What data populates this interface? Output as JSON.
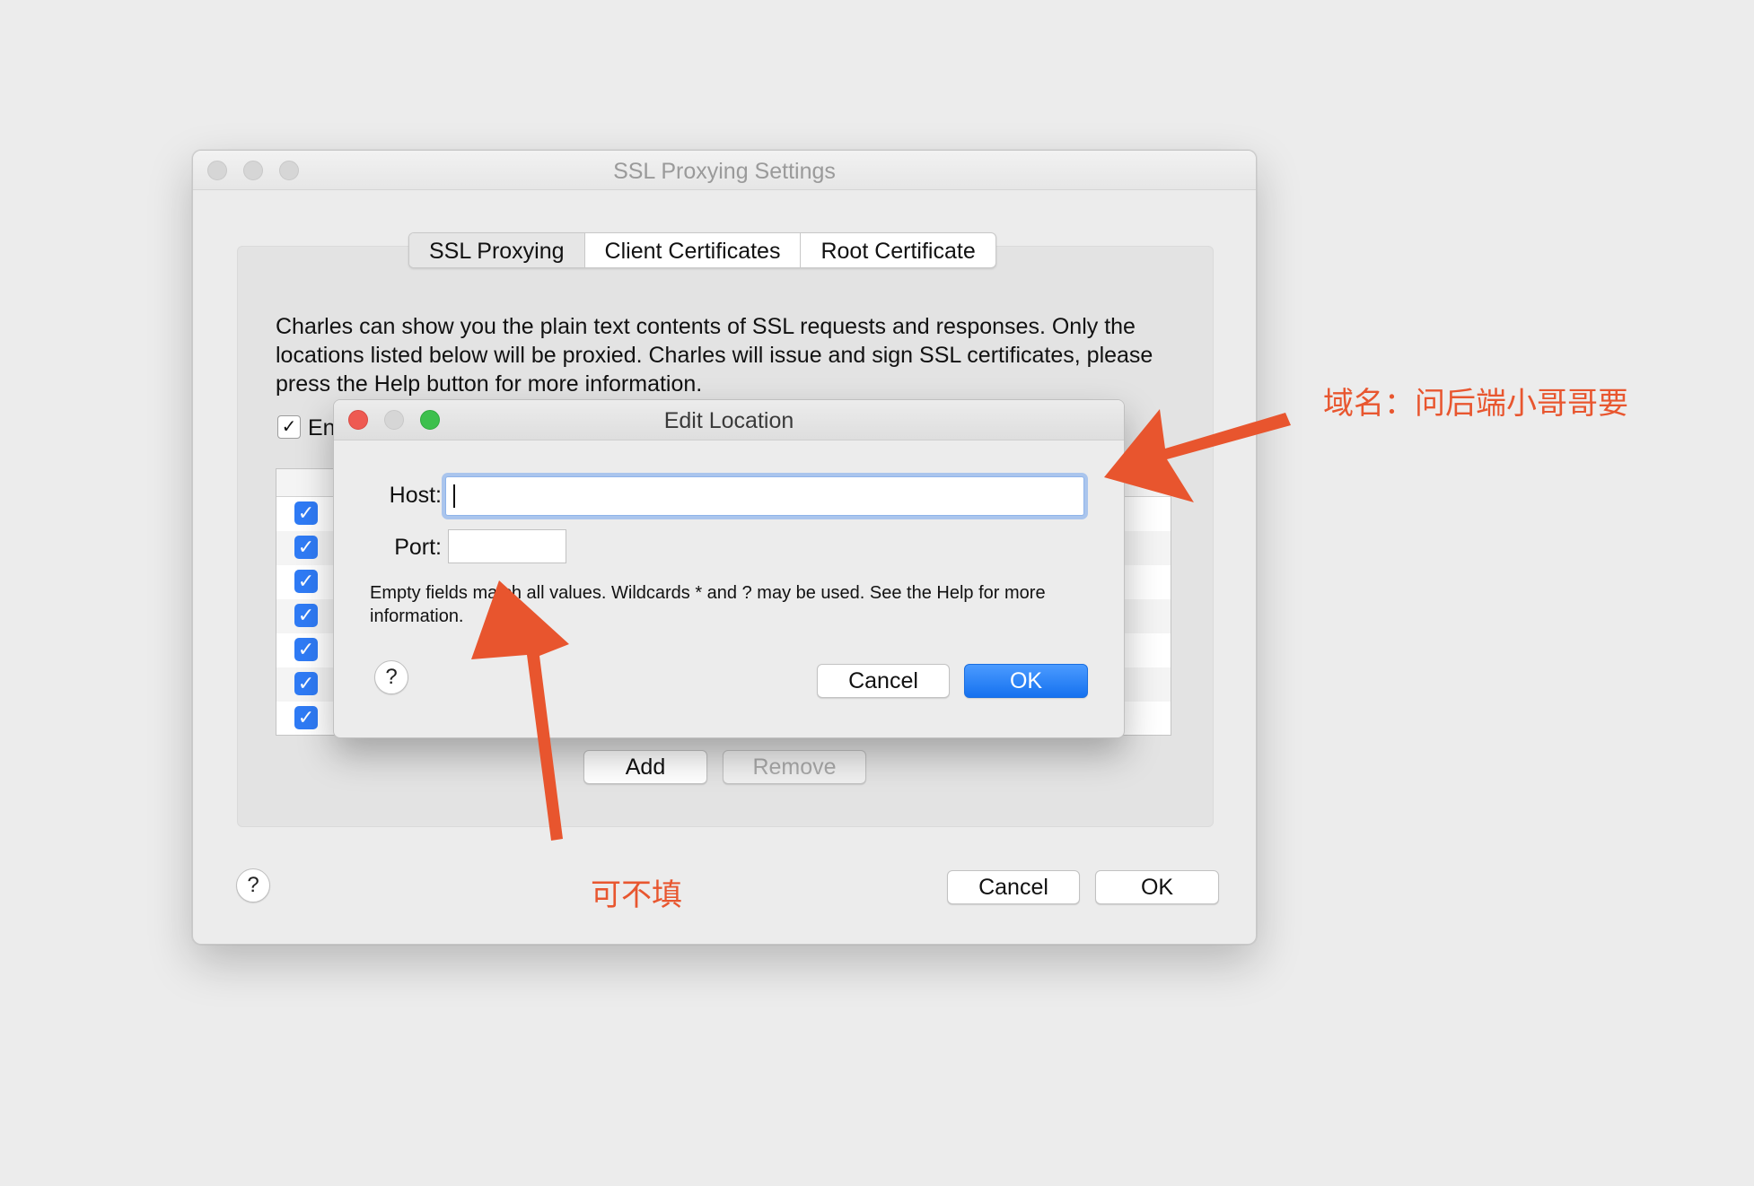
{
  "main_window": {
    "title": "SSL Proxying Settings",
    "tabs": [
      {
        "label": "SSL Proxying",
        "selected": true
      },
      {
        "label": "Client Certificates",
        "selected": false
      },
      {
        "label": "Root Certificate",
        "selected": false
      }
    ],
    "description": "Charles can show you the plain text contents of SSL requests and responses. Only the locations listed below will be proxied. Charles will issue and sign SSL certificates, please press the Help button for more information.",
    "enable_label": "En",
    "enable_checked": "✓",
    "row_check_glyph": "✓",
    "rows": 7,
    "add_label": "Add",
    "remove_label": "Remove",
    "help_label": "?",
    "cancel_label": "Cancel",
    "ok_label": "OK"
  },
  "dialog": {
    "title": "Edit Location",
    "host_label": "Host:",
    "host_value": "",
    "port_label": "Port:",
    "port_value": "",
    "note": "Empty fields match all values. Wildcards * and ? may be used. See the Help for more information.",
    "help_label": "?",
    "cancel_label": "Cancel",
    "ok_label": "OK"
  },
  "annotations": {
    "host_note": "域名：问后端小哥哥要",
    "port_note": "可不填"
  },
  "colors": {
    "annotation": "#e8562f",
    "accent": "#1e74f0",
    "close": "#ee5a52",
    "minimize": "#c8c8c8",
    "zoom": "#3dc04d"
  }
}
